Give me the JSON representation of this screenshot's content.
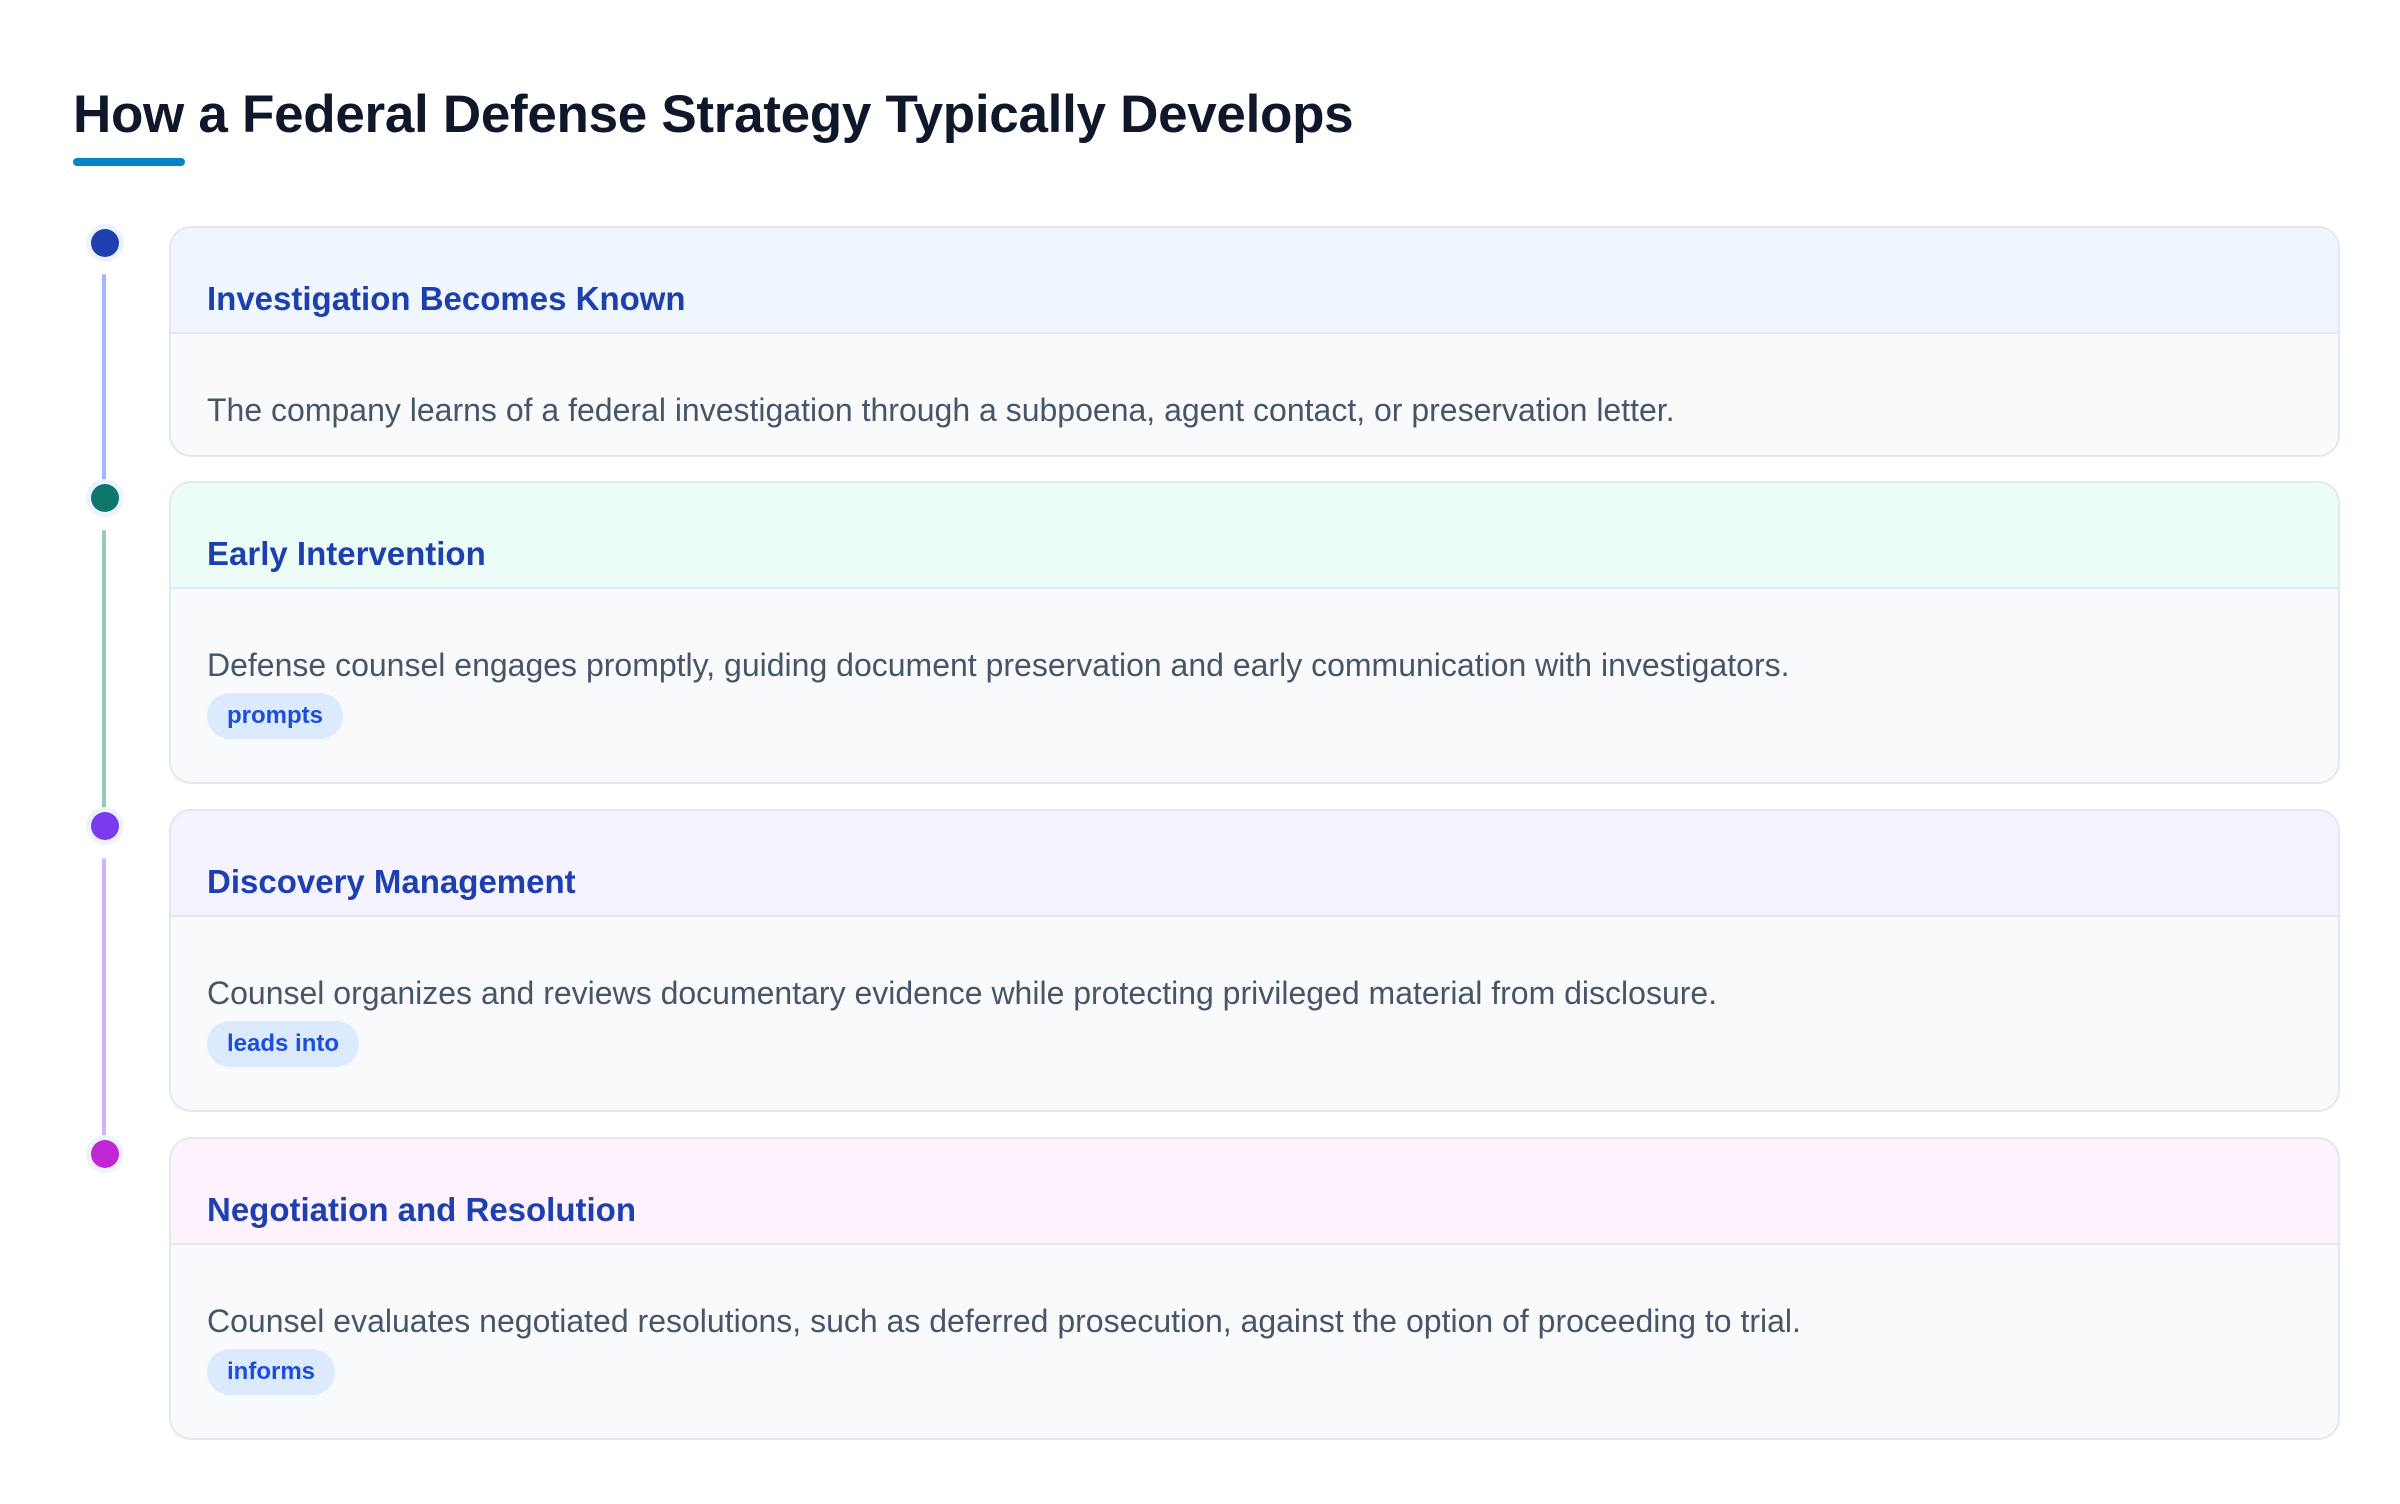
{
  "title": "How a Federal Defense Strategy Typically Develops",
  "colors": {
    "title_underline": "#0284c7",
    "card_title": "#1e40af",
    "tag_background": "#dbeafe",
    "tag_text": "#1d4ed8"
  },
  "steps": [
    {
      "title": "Investigation Becomes Known",
      "description": "The company learns of a federal investigation through a subpoena, agent contact, or preservation letter.",
      "tag": "",
      "dot_color": "#1e40af",
      "connector_color": "#a5b4fc",
      "header_color": "#eff6ff"
    },
    {
      "title": "Early Intervention",
      "description": "Defense counsel engages promptly, guiding document preservation and early communication with investigators.",
      "tag": "prompts",
      "dot_color": "#0f766e",
      "connector_color": "#99c8c0",
      "header_color": "#ecfdf8"
    },
    {
      "title": "Discovery Management",
      "description": "Counsel organizes and reviews documentary evidence while protecting privileged material from disclosure.",
      "tag": "leads into",
      "dot_color": "#7c3aed",
      "connector_color": "#d0b4f7",
      "header_color": "#f5f3ff"
    },
    {
      "title": "Negotiation and Resolution",
      "description": "Counsel evaluates negotiated resolutions, such as deferred prosecution, against the option of proceeding to trial.",
      "tag": "informs",
      "dot_color": "#c026d3",
      "connector_color": "",
      "header_color": "#fdf2fd"
    }
  ]
}
